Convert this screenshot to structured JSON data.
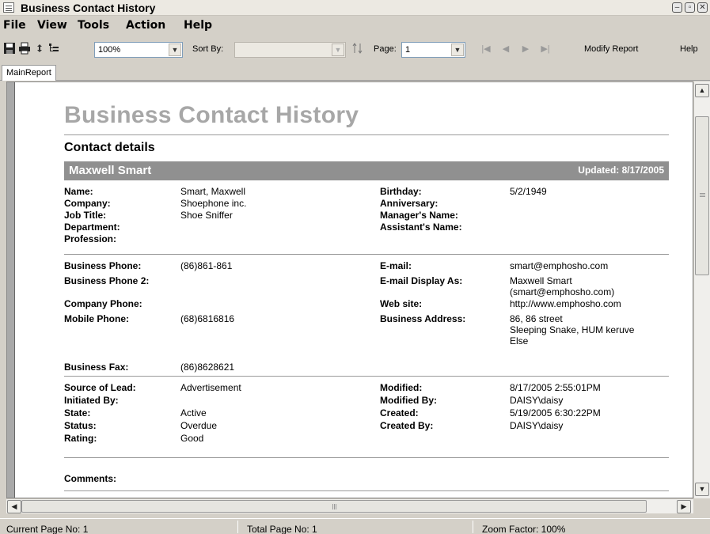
{
  "window": {
    "title": "Business Contact History",
    "icon": "app-window-icon",
    "controls": [
      "minimize-icon",
      "maximize-icon",
      "close-icon"
    ]
  },
  "menu": {
    "items": [
      "File",
      "View",
      "Tools",
      "Action",
      "Help"
    ]
  },
  "toolbar": {
    "icons": [
      "save-icon",
      "print-icon",
      "refresh-icon",
      "tree-icon"
    ],
    "zoom_value": "100%",
    "sort_label": "Sort By:",
    "sort_value": "",
    "page_label": "Page:",
    "page_value": "1",
    "nav_icons": [
      "first-page-icon",
      "prev-page-icon",
      "next-page-icon",
      "last-page-icon"
    ],
    "modify_report": "Modify Report",
    "help": "Help"
  },
  "tabs": [
    "MainReport"
  ],
  "report": {
    "title": "Business Contact History",
    "section_title": "Contact details",
    "contact_name": "Maxwell Smart",
    "updated": "Updated: 8/17/2005",
    "general_left": {
      "labels": [
        "Name:",
        "Company:",
        "Job Title:",
        "Department:",
        "Profession:"
      ],
      "values": [
        "Smart, Maxwell",
        "Shoephone inc.",
        "Shoe Sniffer",
        "",
        ""
      ]
    },
    "general_right": {
      "labels": [
        "Birthday:",
        "Anniversary:",
        "Manager's Name:",
        "Assistant's Name:"
      ],
      "values": [
        "5/2/1949",
        "",
        "",
        ""
      ]
    },
    "contact_left": {
      "labels": [
        "Business Phone:",
        "Business Phone 2:",
        "Company Phone:",
        "Mobile Phone:",
        "Business Fax:"
      ],
      "values": [
        "(86)861-861",
        "",
        "",
        "(68)6816816",
        "(86)8628621"
      ]
    },
    "contact_right": {
      "labels": [
        "E-mail:",
        "E-mail Display As:",
        "Web site:",
        "Business Address:"
      ],
      "values": [
        "smart@emphosho.com",
        "Maxwell Smart",
        "(smart@emphosho.com)",
        "http://www.emphosho.com",
        "86, 86 street",
        "Sleeping Snake, HUM keruve",
        "Else"
      ]
    },
    "lead_left": {
      "labels": [
        "Source of Lead:",
        "Initiated By:",
        "State:",
        "Status:",
        "Rating:"
      ],
      "values": [
        "Advertisement",
        "",
        "Active",
        "Overdue",
        "Good"
      ]
    },
    "lead_right": {
      "labels": [
        "Modified:",
        "Modified By:",
        "Created:",
        "Created By:"
      ],
      "values": [
        "8/17/2005  2:55:01PM",
        "DAISY\\daisy",
        "5/19/2005  6:30:22PM",
        "DAISY\\daisy"
      ]
    },
    "comments_label": "Comments:"
  },
  "status": {
    "current_page": "Current Page No: 1",
    "total_page": "Total Page No: 1",
    "zoom": "Zoom Factor: 100%"
  },
  "colors": {
    "banner": "#909090",
    "title": "#a7a7a7",
    "chrome": "#d4d0c8"
  }
}
